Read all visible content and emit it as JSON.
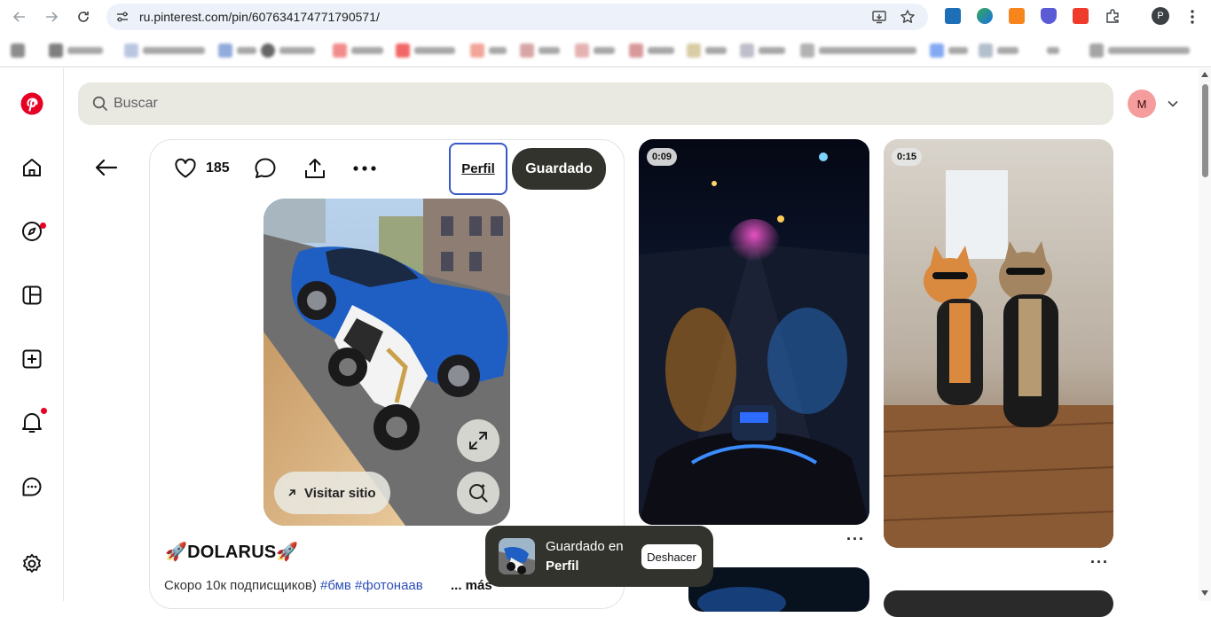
{
  "browser": {
    "url": "ru.pinterest.com/pin/607634174771790571/",
    "profile_initial": "P"
  },
  "pinterest": {
    "search_placeholder": "Buscar",
    "account_initial": "M",
    "nav_icons": [
      "pinterest-logo",
      "home",
      "explore",
      "boards",
      "create",
      "notifications",
      "messages",
      "settings"
    ]
  },
  "pin": {
    "like_count": "185",
    "board_button": "Perfil",
    "save_button": "Guardado",
    "visit_site": "Visitar sitio",
    "title": "🚀DOLARUS🚀",
    "description_text": "Скоро 10к подписщиков) ",
    "description_tags": "#бмв #фотонаав",
    "more_label": "... más"
  },
  "feed": [
    {
      "duration": "0:09",
      "subject": "motorcycle night road"
    },
    {
      "duration": "0:15",
      "subject": "kittens in leather jackets"
    }
  ],
  "toast": {
    "line1": "Guardado en",
    "line2": "Perfil",
    "undo": "Deshacer"
  },
  "colors": {
    "pinterest_red": "#e60023",
    "dark_button": "#33332d",
    "search_bg": "#e9e9e2",
    "board_outline": "#3a57c8"
  }
}
